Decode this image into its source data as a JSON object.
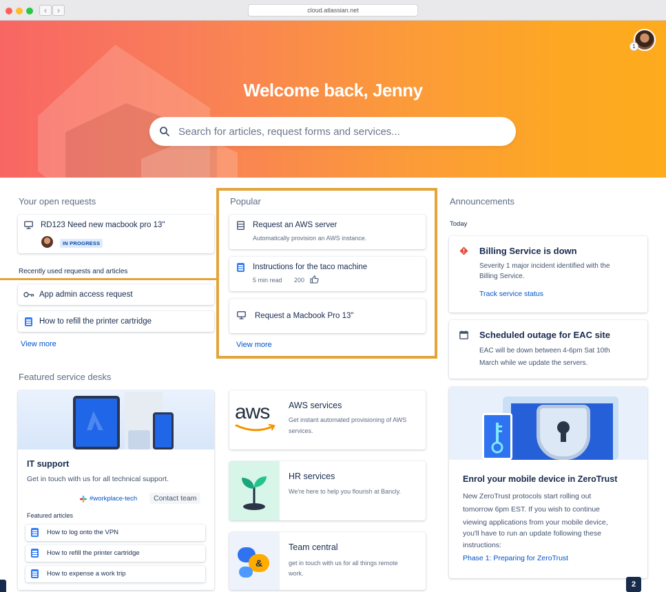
{
  "browser": {
    "url": "cloud.atlassian.net"
  },
  "hero": {
    "title": "Welcome back, Jenny",
    "search_placeholder": "Search for articles, request forms and services...",
    "avatar_badge": "1"
  },
  "open_requests": {
    "heading": "Your open requests",
    "items": [
      {
        "id_title": "RD123  Need new macbook pro 13\"",
        "status": "IN PROGRESS"
      }
    ]
  },
  "recent": {
    "heading": "Recently used requests and articles",
    "items": [
      {
        "label": "App admin access request"
      },
      {
        "label": "How to refill the printer cartridge"
      }
    ],
    "view_more": "View more"
  },
  "popular": {
    "heading": "Popular",
    "items": [
      {
        "title": "Request an AWS server",
        "subtitle": "Automatically provision an AWS instance."
      },
      {
        "title": "Instructions for the taco machine",
        "meta": "5 min read",
        "likes": "200"
      },
      {
        "title": "Request a Macbook Pro 13\""
      }
    ],
    "view_more": "View more"
  },
  "announcements": {
    "heading": "Announcements",
    "day": "Today",
    "items": [
      {
        "title": "Billing Service is down",
        "body1": "Severity 1 major incident identified with the",
        "body2": "Billing Service.",
        "link": "Track service status"
      },
      {
        "title": "Scheduled outage for EAC site",
        "body1": "EAC will be down between 4-6pm Sat 10th",
        "body2": "March while we update the servers."
      }
    ],
    "promo": {
      "title": "Enrol your mobile device in ZeroTrust",
      "lines": [
        "New ZeroTrust protocols start rolling out",
        "tomorrow 6pm EST. If you wish to continue",
        "viewing applications from your mobile device,",
        "you'll have to run an update following these",
        "instructions:"
      ],
      "link": "Phase 1: Preparing for ZeroTrust"
    }
  },
  "featured": {
    "heading": "Featured service desks",
    "it": {
      "title": "IT support",
      "desc": "Get in touch with us for all technical support.",
      "channel": "#workplace-tech",
      "contact": "Contact team",
      "articles_heading": "Featured articles",
      "articles": [
        "How to log onto the VPN",
        "How to refill the printer cartridge",
        "How to expense a work trip"
      ]
    },
    "desks": [
      {
        "logo": "aws",
        "title": "AWS services",
        "desc1": "Get instant automated provisioning of AWS",
        "desc2": "services."
      },
      {
        "title": "HR services",
        "desc1": "We're here to help you flourish at Bancly."
      },
      {
        "title": "Team central",
        "desc1": "get in touch with us for all things remote",
        "desc2": "work."
      }
    ]
  },
  "step_badge": "2",
  "colors": {
    "accent": "#e3a43a",
    "link": "#0052cc",
    "hero_start": "#f86664",
    "hero_end": "#feab1d"
  }
}
